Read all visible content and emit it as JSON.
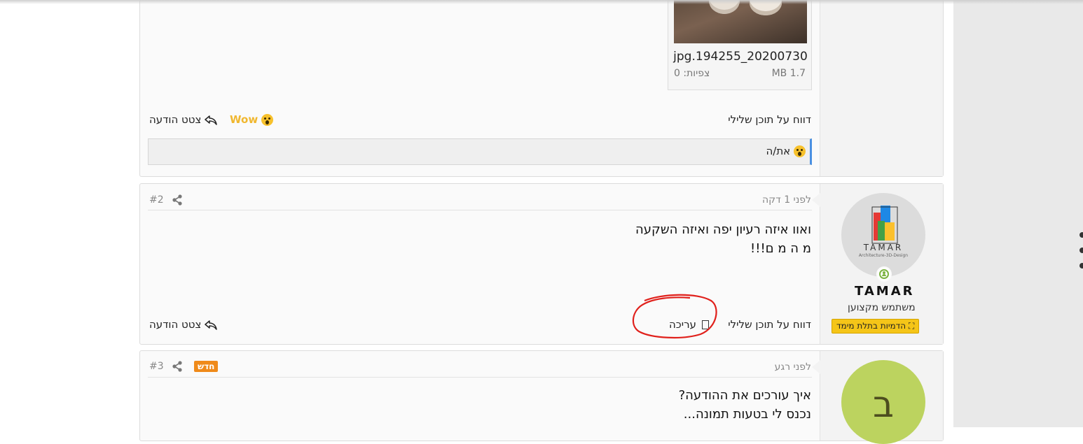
{
  "post1": {
    "attachment": {
      "filename": "jpg.194255_20200730",
      "size": "MB 1.7",
      "views": "צפיות: 0"
    },
    "report": "דווח על תוכן שלילי",
    "reaction": "Wow",
    "quote": "צטט הודעה",
    "reactions_bar": "את/ה"
  },
  "post2": {
    "date": "לפני 1 דקה",
    "number": "#2",
    "message_line1": "ואוו איזה רעיון יפה ואיזה השקעה",
    "message_line2": "מ ה מ ם!!!",
    "report": "דווח על תוכן שלילי",
    "edit": "עריכה",
    "quote": "צטט הודעה",
    "user": {
      "logo_text": "TAMAR",
      "logo_sub": "Architecture-3D-Design",
      "name": "TAMAR",
      "title": "משתמש מקצוען",
      "badge": "הדמיות בתלת מימד"
    }
  },
  "post3": {
    "date": "לפני רגע",
    "number": "#3",
    "new_badge": "חדש",
    "message_line1": "איך עורכים את ההודעה?",
    "message_line2": "נכנס לי בטעות תמונה...",
    "user": {
      "avatar_letter": "ב",
      "avatar_color": "#bcd35f"
    }
  },
  "colors": {
    "accent": "#4a90e2",
    "badge": "#f5c518",
    "new": "#ef8a1a",
    "annotation": "#e0201b"
  }
}
